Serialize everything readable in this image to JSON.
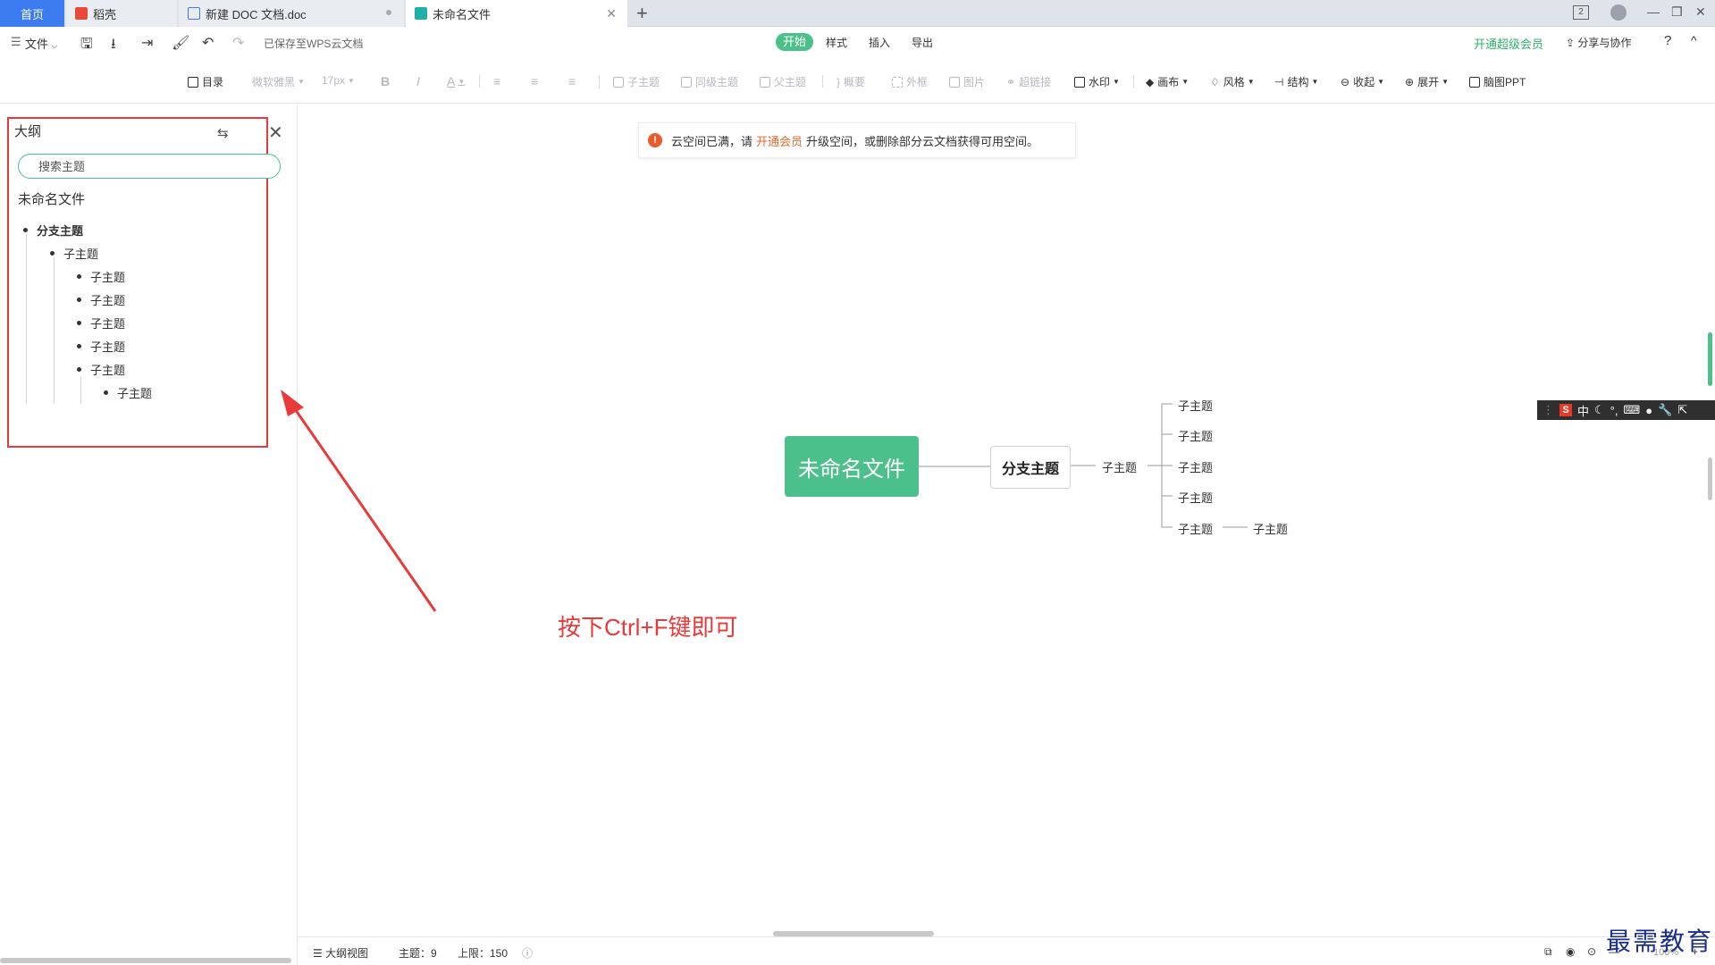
{
  "tabs": {
    "home": "首页",
    "daoke": "稻壳",
    "doc": "新建 DOC 文档.doc",
    "current": "未命名文件",
    "new_tab_symbol": "+"
  },
  "window": {
    "badge": "2",
    "minimize": "—",
    "restore": "❐",
    "close": "✕"
  },
  "menu": {
    "file": "文件",
    "saved_status": "已保存至WPS云文档",
    "tabs": [
      "开始",
      "样式",
      "插入",
      "导出"
    ],
    "vip": "开通超级会员",
    "share": "分享与协作",
    "help": "?",
    "collapse": "^"
  },
  "toolbar": {
    "toc": "目录",
    "font": "微软雅黑",
    "size": "17px",
    "bold": "B",
    "italic": "I",
    "color": "A",
    "child_topic": "子主题",
    "sibling_topic": "同级主题",
    "parent_topic": "父主题",
    "summary": "概要",
    "boundary": "外框",
    "image": "图片",
    "hyperlink": "超链接",
    "watermark": "水印",
    "canvas": "画布",
    "style": "风格",
    "structure": "结构",
    "collapse": "收起",
    "expand": "展开",
    "ppt": "脑图PPT"
  },
  "outline": {
    "title": "大纲",
    "search_placeholder": "搜索主题",
    "doc_name": "未命名文件",
    "branch": "分支主题",
    "level2": "子主题",
    "level3": [
      "子主题",
      "子主题",
      "子主题",
      "子主题",
      "子主题"
    ],
    "level4": "子主题"
  },
  "notice": {
    "icon": "!",
    "prefix": "云空间已满，请",
    "link": "开通会员",
    "suffix": "升级空间，或删除部分云文档获得可用空间。"
  },
  "mindmap": {
    "root": "未命名文件",
    "branch": "分支主题",
    "sub": "子主题",
    "children": [
      "子主题",
      "子主题",
      "子主题",
      "子主题",
      "子主题"
    ],
    "grandchild": "子主题"
  },
  "annotation": "按下Ctrl+F键即可",
  "ime": {
    "logo": "S",
    "mode": "中"
  },
  "status": {
    "outline_view": "大纲视图",
    "topics": "主题：9",
    "limit": "上限：150",
    "zoom": "100%"
  },
  "watermark": "最需教育",
  "colors": {
    "accent": "#4cc08a",
    "annotation": "#e83a3a",
    "tab_home": "#3d7cf0"
  }
}
